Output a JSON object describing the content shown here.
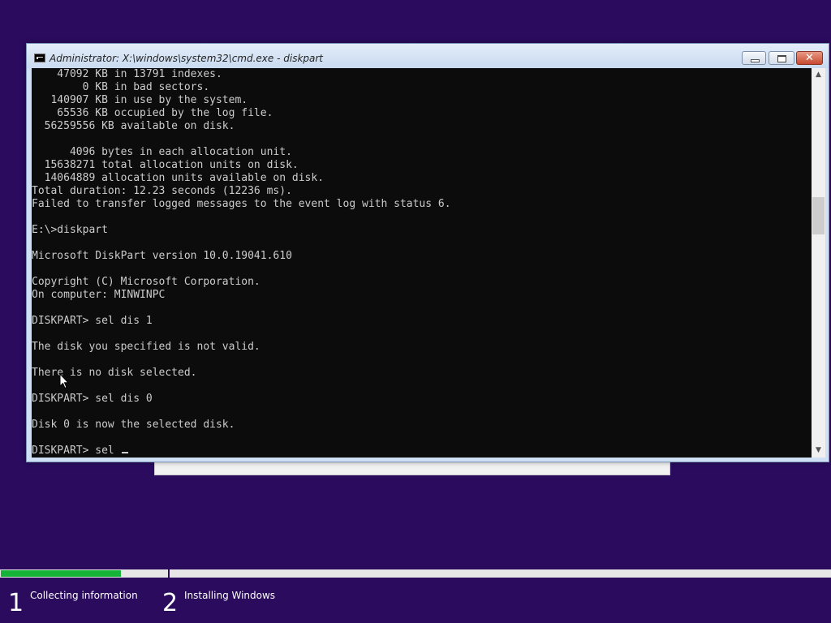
{
  "window": {
    "title": "Administrator: X:\\windows\\system32\\cmd.exe - diskpart",
    "icon": "console-icon",
    "controls": [
      "minimize-icon",
      "maximize-icon",
      "close-icon"
    ],
    "close_glyph": "✕"
  },
  "console": {
    "lines": [
      "    47092 KB in 13791 indexes.",
      "        0 KB in bad sectors.",
      "   140907 KB in use by the system.",
      "    65536 KB occupied by the log file.",
      "  56259556 KB available on disk.",
      "",
      "      4096 bytes in each allocation unit.",
      "  15638271 total allocation units on disk.",
      "  14064889 allocation units available on disk.",
      "Total duration: 12.23 seconds (12236 ms).",
      "Failed to transfer logged messages to the event log with status 6.",
      "",
      "E:\\>diskpart",
      "",
      "Microsoft DiskPart version 10.0.19041.610",
      "",
      "Copyright (C) Microsoft Corporation.",
      "On computer: MINWINPC",
      "",
      "DISKPART> sel dis 1",
      "",
      "The disk you specified is not valid.",
      "",
      "There is no disk selected.",
      "",
      "DISKPART> sel dis 0",
      "",
      "Disk 0 is now the selected disk.",
      ""
    ],
    "prompt_line": "DISKPART> sel ",
    "colors": {
      "background": "#0c0c0c",
      "text": "#cccccc"
    }
  },
  "scrollbar": {
    "up_glyph": "▲",
    "down_glyph": "▼"
  },
  "setup": {
    "progress_fraction": 0.145,
    "progress_color": "#16b339",
    "steps": [
      {
        "number": "1",
        "label": "Collecting information"
      },
      {
        "number": "2",
        "label": "Installing Windows"
      }
    ]
  }
}
